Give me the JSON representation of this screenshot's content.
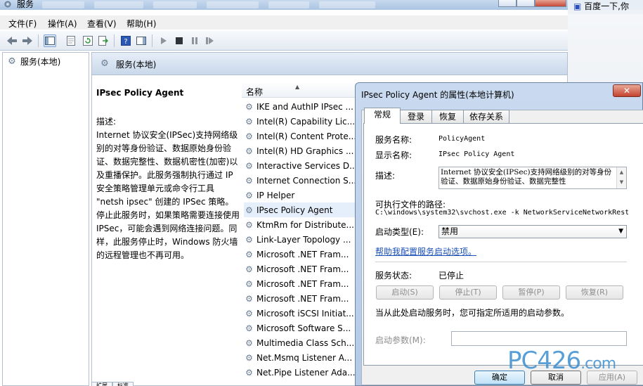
{
  "window": {
    "title": "服务",
    "menu": [
      "文件(F)",
      "操作(A)",
      "查看(V)",
      "帮助(H)"
    ]
  },
  "tree": {
    "root": "服务(本地)"
  },
  "content": {
    "header": "服务(本地)",
    "description": {
      "service_name": "IPsec Policy Agent",
      "label": "描述:",
      "text": "Internet 协议安全(IPSec)支持网络级别的对等身份验证、数据原始身份验证、数据完整性、数据机密性(加密)以及重播保护。此服务强制执行通过 IP 安全策略管理单元或命令行工具 \"netsh ipsec\" 创建的 IPSec 策略。停止此服务时，如果策略需要连接使用 IPSec，可能会遇到网络连接问题。同样，此服务停止时，Windows 防火墙的远程管理也不再可用。"
    },
    "list": {
      "column_name": "名称",
      "rows": [
        "IKE and AuthIP IPsec ...",
        "Intel(R) Capability Lic...",
        "Intel(R) Content Prote...",
        "Intel(R) HD Graphics ...",
        "Interactive Services D...",
        "Internet Connection S...",
        "IP Helper",
        "IPsec Policy Agent",
        "KtmRm for Distribute...",
        "Link-Layer Topology ...",
        "Microsoft .NET Fram...",
        "Microsoft .NET Fram...",
        "Microsoft .NET Fram...",
        "Microsoft .NET Fram...",
        "Microsoft iSCSI Initiat...",
        "Microsoft Software S...",
        "Multimedia Class Sch...",
        "Net.Msmq Listener A...",
        "Net.Pipe Listener Ada..."
      ],
      "selected_index": 7
    },
    "bottom_tabs": [
      "扩展",
      "标准"
    ]
  },
  "browser": {
    "search_text": "百度一下,你"
  },
  "dialog": {
    "title": "IPsec Policy Agent 的属性(本地计算机)",
    "close_glyph": "✕",
    "tabs": [
      "常规",
      "登录",
      "恢复",
      "依存关系"
    ],
    "fields": {
      "service_name_label": "服务名称:",
      "service_name_value": "PolicyAgent",
      "display_name_label": "显示名称:",
      "display_name_value": "IPsec Policy Agent",
      "description_label": "描述:",
      "description_value": "Internet 协议安全(IPSec)支持网络级别的对等身份验证、数据原始身份验证、数据完整性",
      "path_label": "可执行文件的路径:",
      "path_value": "C:\\windows\\system32\\svchost.exe -k NetworkServiceNetworkRest",
      "startup_type_label": "启动类型(E):",
      "startup_type_value": "禁用",
      "help_link": "帮助我配置服务启动选项。",
      "status_label": "服务状态:",
      "status_value": "已停止",
      "start_params_hint": "当从此处启动服务时，您可指定所适用的启动参数。",
      "start_params_label": "启动参数(M):"
    },
    "service_buttons": [
      "启动(S)",
      "停止(T)",
      "暂停(P)",
      "恢复(R)"
    ],
    "footer_buttons": {
      "ok": "确定",
      "cancel": "取消",
      "apply": "应用(A)"
    }
  },
  "watermark": {
    "main": "PC426",
    "suffix": ".com"
  }
}
